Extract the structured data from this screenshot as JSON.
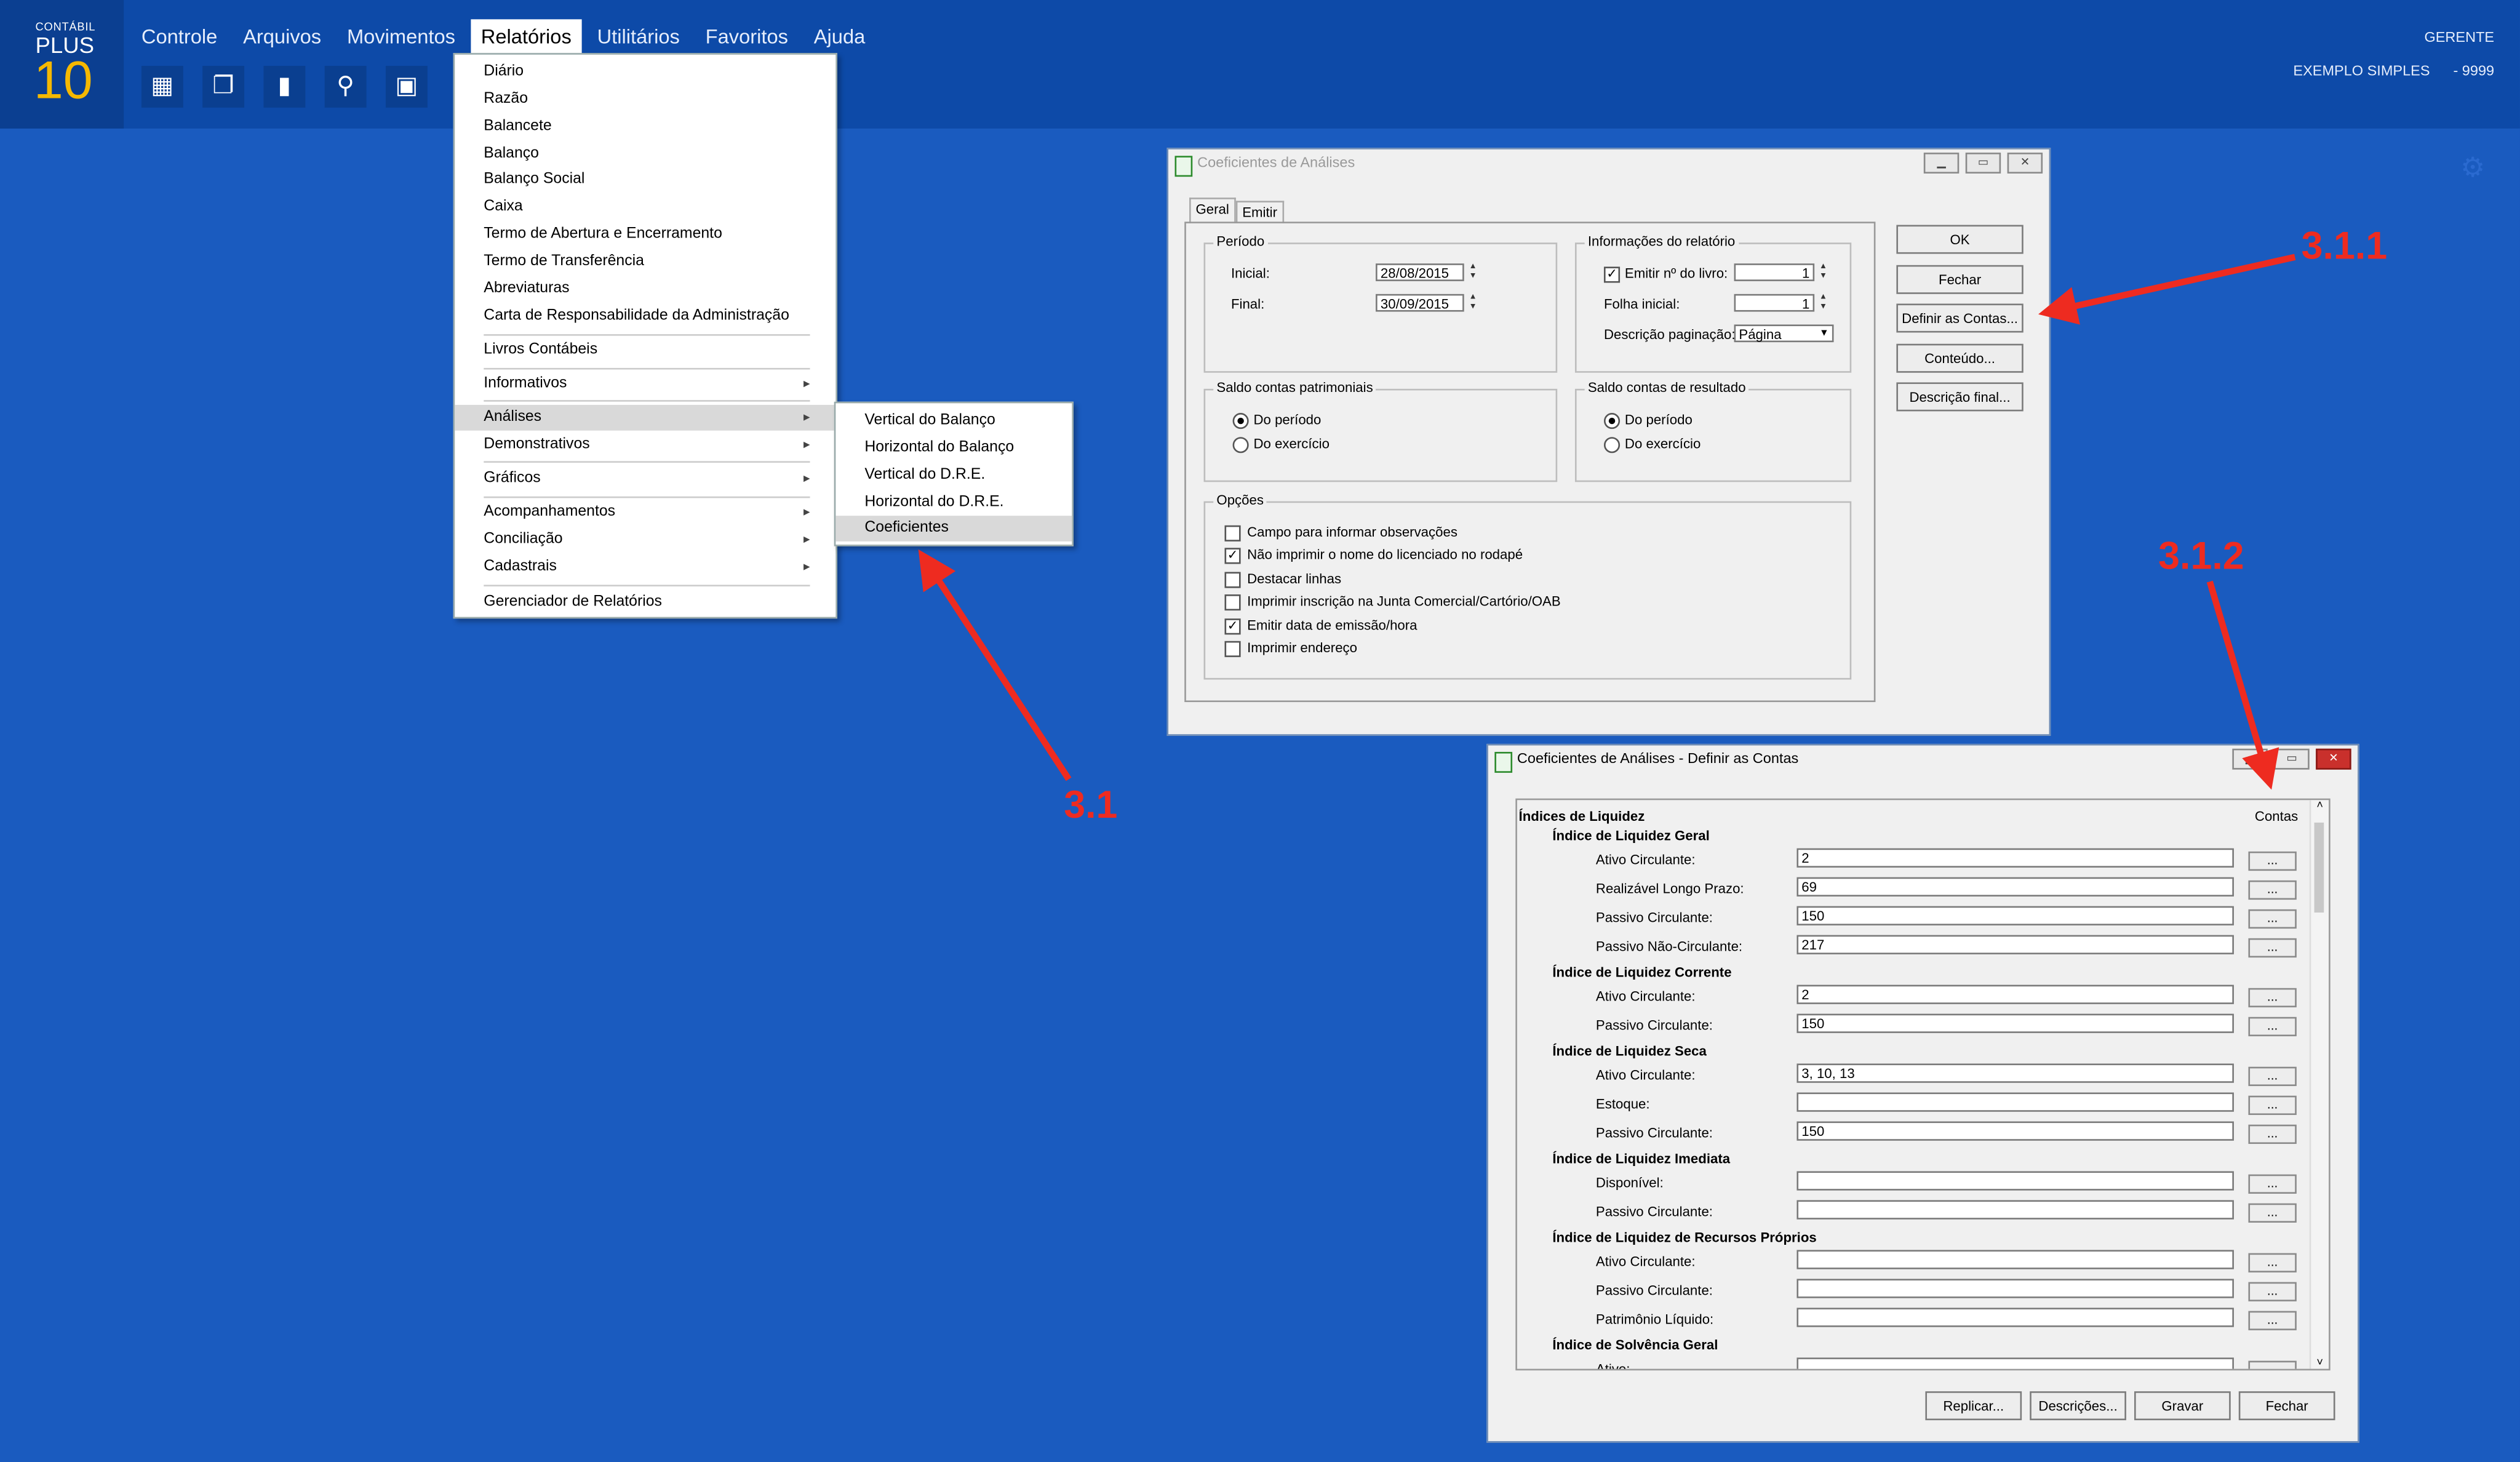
{
  "app": {
    "brand_top": "CONTÁBIL",
    "brand_mid": "PLUS",
    "brand_num": "10",
    "user": "GERENTE",
    "company": "EXEMPLO SIMPLES",
    "company_code": "- 9999"
  },
  "menubar": [
    "Controle",
    "Arquivos",
    "Movimentos",
    "Relatórios",
    "Utilitários",
    "Favoritos",
    "Ajuda"
  ],
  "toolbar_icons": [
    "building-icon",
    "copy-icon",
    "document-icon",
    "search-icon",
    "card-icon"
  ],
  "relatorios_menu": [
    "Diário",
    "Razão",
    "Balancete",
    "Balanço",
    "Balanço Social",
    "Caixa",
    "Termo de Abertura e Encerramento",
    "Termo de Transferência",
    "Abreviaturas",
    "Carta de Responsabilidade da Administração",
    "Livros Contábeis",
    "Informativos",
    "Análises",
    "Demonstrativos",
    "Gráficos",
    "Acompanhamentos",
    "Conciliação",
    "Cadastrais",
    "Gerenciador de Relatórios"
  ],
  "analises_submenu": [
    "Vertical do Balanço",
    "Horizontal do Balanço",
    "Vertical do D.R.E.",
    "Horizontal do D.R.E.",
    "Coeficientes"
  ],
  "dialog1": {
    "title": "Coeficientes de Análises",
    "tabs": [
      "Geral",
      "Emitir"
    ],
    "periodo": {
      "caption": "Período",
      "inicial_label": "Inicial:",
      "inicial": "28/08/2015",
      "final_label": "Final:",
      "final": "30/09/2015"
    },
    "info": {
      "caption": "Informações do relatório",
      "emitir_label": "Emitir nº do livro:",
      "emitir_value": "1",
      "folha_label": "Folha inicial:",
      "folha_value": "1",
      "desc_label": "Descrição paginação:",
      "desc_value": "Página"
    },
    "saldo_pat": {
      "caption": "Saldo contas patrimoniais",
      "opt1": "Do período",
      "opt2": "Do exercício"
    },
    "saldo_res": {
      "caption": "Saldo contas de resultado",
      "opt1": "Do período",
      "opt2": "Do exercício"
    },
    "opcoes": {
      "caption": "Opções",
      "items": [
        "Campo para informar observações",
        "Não imprimir o nome do licenciado no rodapé",
        "Destacar linhas",
        "Imprimir inscrição na Junta Comercial/Cartório/OAB",
        "Emitir data de emissão/hora",
        "Imprimir endereço"
      ]
    },
    "buttons": [
      "OK",
      "Fechar",
      "Definir as Contas...",
      "Conteúdo...",
      "Descrição final..."
    ]
  },
  "dialog2": {
    "title": "Coeficientes de Análises - Definir as Contas",
    "contas_header": "Contas",
    "section": "Índices de Liquidez",
    "groups": [
      {
        "title": "Índice de Liquidez Geral",
        "rows": [
          [
            "Ativo Circulante:",
            "2"
          ],
          [
            "Realizável Longo Prazo:",
            "69"
          ],
          [
            "Passivo Circulante:",
            "150"
          ],
          [
            "Passivo Não-Circulante:",
            "217"
          ]
        ]
      },
      {
        "title": "Índice de Liquidez Corrente",
        "rows": [
          [
            "Ativo Circulante:",
            "2"
          ],
          [
            "Passivo Circulante:",
            "150"
          ]
        ]
      },
      {
        "title": "Índice de Liquidez Seca",
        "rows": [
          [
            "Ativo Circulante:",
            "3, 10, 13"
          ],
          [
            "Estoque:",
            ""
          ],
          [
            "Passivo Circulante:",
            "150"
          ]
        ]
      },
      {
        "title": "Índice de Liquidez Imediata",
        "rows": [
          [
            "Disponível:",
            ""
          ],
          [
            "Passivo Circulante:",
            ""
          ]
        ]
      },
      {
        "title": "Índice de Liquidez de Recursos Próprios",
        "rows": [
          [
            "Ativo Circulante:",
            ""
          ],
          [
            "Passivo Circulante:",
            ""
          ],
          [
            "Patrimônio Líquido:",
            ""
          ]
        ]
      },
      {
        "title": "Índice de Solvência Geral",
        "rows": [
          [
            "Ativo:",
            ""
          ]
        ]
      }
    ],
    "dots": "...",
    "buttons": [
      "Replicar...",
      "Descrições...",
      "Gravar",
      "Fechar"
    ]
  },
  "annotations": {
    "a1": "3.1",
    "a2": "3.1.1",
    "a3": "3.1.2",
    "color": "#ee2b20"
  }
}
